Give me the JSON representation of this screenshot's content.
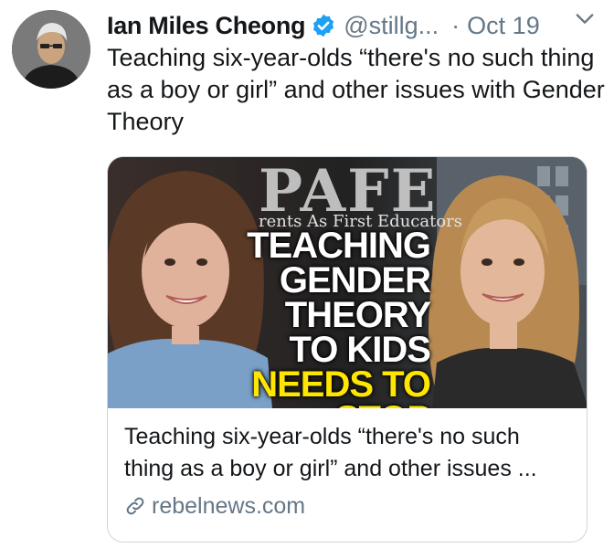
{
  "author": {
    "display_name": "Ian Miles Cheong",
    "handle": "@stillg...",
    "separator": "·",
    "date": "Oct 19",
    "verified": true
  },
  "tweet": {
    "text": "Teaching six-year-olds “there's no such thing as a boy or girl” and other issues with Gender Theory"
  },
  "card": {
    "image": {
      "brand": "PAFE",
      "brand_subtitle": "rents As First Educators",
      "headline_white": "TEACHING GENDER THEORY TO KIDS",
      "headline_yellow_1": "NEEDS",
      "headline_yellow_2": "TO STOP"
    },
    "title": "Teaching six-year-olds “there's no such thing as a boy or girl” and other issues ...",
    "source": "rebelnews.com"
  },
  "icons": {
    "verified": "verified-badge-icon",
    "caret": "chevron-down-icon",
    "link": "link-icon"
  },
  "colors": {
    "verified_blue": "#1da1f2",
    "secondary_text": "#657786",
    "headline_yellow": "#ffe600"
  }
}
